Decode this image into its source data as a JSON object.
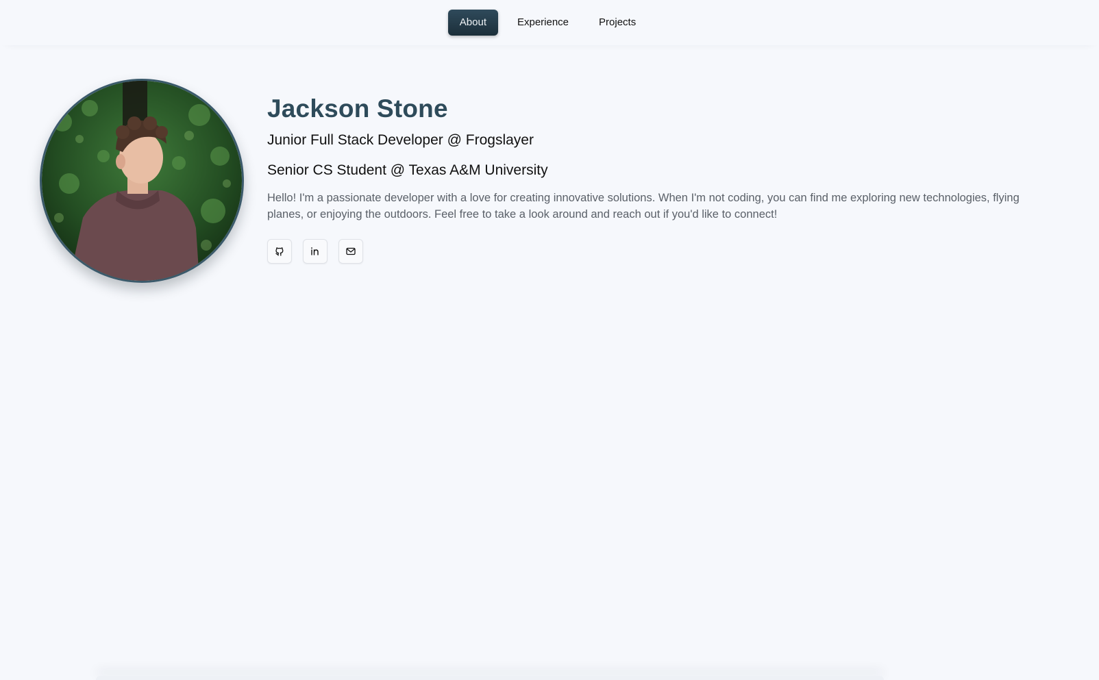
{
  "nav": {
    "items": [
      {
        "label": "About",
        "active": true
      },
      {
        "label": "Experience",
        "active": false
      },
      {
        "label": "Projects",
        "active": false
      }
    ]
  },
  "profile": {
    "name": "Jackson Stone",
    "role_primary": "Junior Full Stack Developer @ Frogslayer",
    "role_secondary": "Senior CS Student @ Texas A&M University",
    "bio": "Hello! I'm a passionate developer with a love for creating innovative solutions. When I'm not coding, you can find me exploring new technologies, flying planes, or enjoying the outdoors. Feel free to take a look around and reach out if you'd like to connect!",
    "photo_icon": "profile-photo"
  },
  "socials": [
    {
      "icon": "github-icon"
    },
    {
      "icon": "linkedin-icon"
    },
    {
      "icon": "mail-icon"
    }
  ],
  "colors": {
    "background": "#f6f8fc",
    "accent": "#2e4b5a",
    "active_nav": "#1c2f3a",
    "body_text": "#5a6068"
  }
}
